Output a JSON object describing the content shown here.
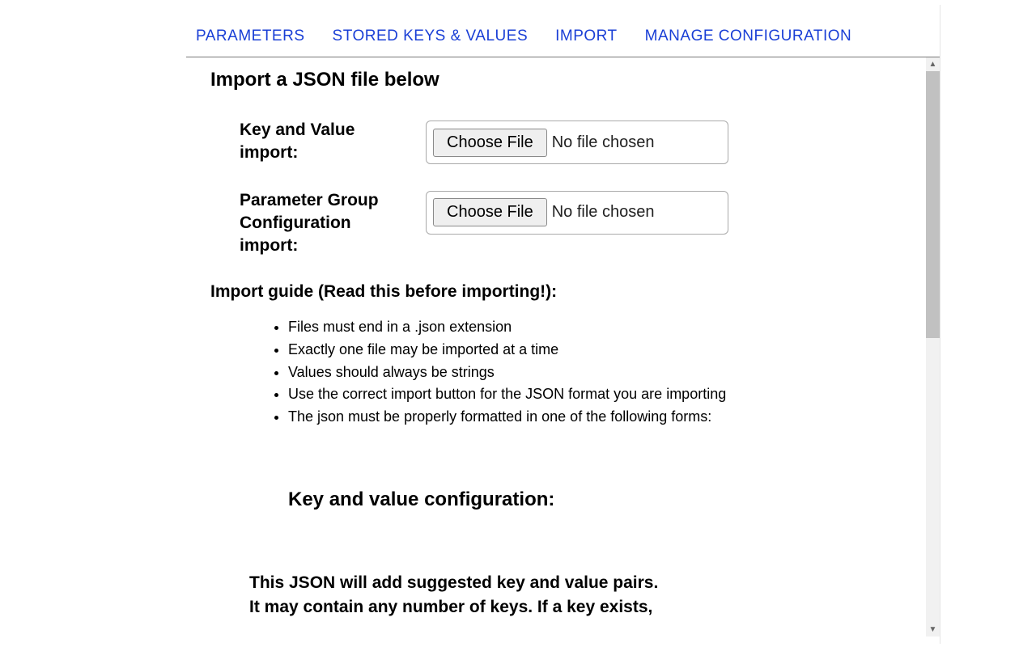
{
  "tabs": {
    "parameters": "PARAMETERS",
    "stored": "STORED KEYS & VALUES",
    "import": "IMPORT",
    "manage": "MANAGE CONFIGURATION"
  },
  "heading": "Import a JSON file below",
  "rows": {
    "kv_label": "Key and Value import:",
    "kv_button": "Choose File",
    "kv_status": "No file chosen",
    "pg_label": "Parameter Group Configuration import:",
    "pg_button": "Choose File",
    "pg_status": "No file chosen"
  },
  "guide_heading": "Import guide (Read this before importing!):",
  "guide_items": [
    "Files must end in a .json extension",
    "Exactly one file may be imported at a time",
    "Values should always be strings",
    "Use the correct import button for the JSON format you are importing",
    "The json must be properly formatted in one of the following forms:"
  ],
  "sub_heading": "Key and value configuration:",
  "desc_line1": "This JSON will add suggested key and value pairs.",
  "desc_line2": "It may contain any number of keys. If a key exists,"
}
